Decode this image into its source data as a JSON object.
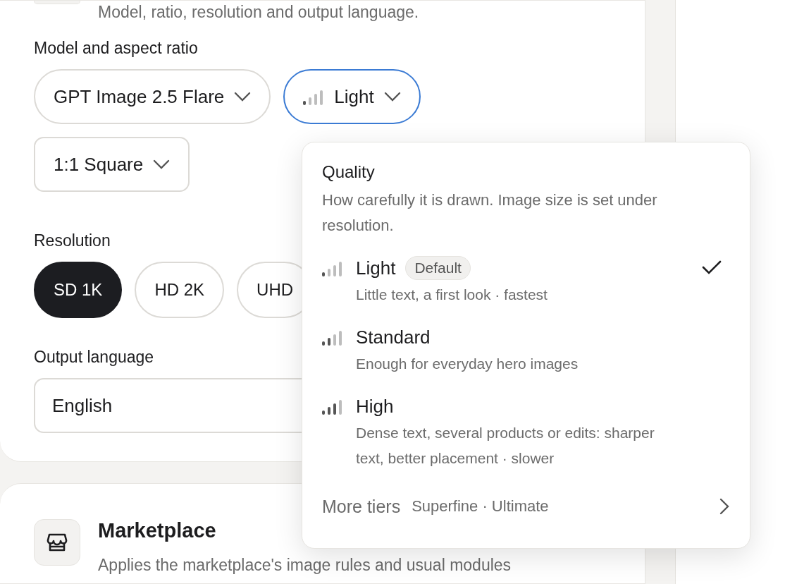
{
  "section": {
    "description": "Model, ratio, resolution and output language."
  },
  "model_group": {
    "label": "Model and aspect ratio",
    "model": "GPT Image 2.5 Flare",
    "quality": "Light",
    "quality_open": true,
    "aspect_ratio": "1:1 Square"
  },
  "resolution": {
    "label": "Resolution",
    "options": [
      {
        "label": "SD 1K",
        "selected": true
      },
      {
        "label": "HD 2K",
        "selected": false
      },
      {
        "label": "UHD",
        "selected": false
      }
    ]
  },
  "output_language": {
    "label": "Output language",
    "value": "English"
  },
  "quality_menu": {
    "title": "Quality",
    "description": "How carefully it is drawn. Image size is set under resolution.",
    "options": [
      {
        "label": "Light",
        "badge": "Default",
        "detail": "Little text, a first look · fastest",
        "selected": true
      },
      {
        "label": "Standard",
        "detail": "Enough for everyday hero images",
        "selected": false
      },
      {
        "label": "High",
        "detail": "Dense text, several products or edits: sharper text, better placement · slower",
        "selected": false
      }
    ],
    "more": {
      "label": "More tiers",
      "detail": "Superfine · Ultimate"
    }
  },
  "marketplace": {
    "title": "Marketplace",
    "description": "Applies the marketplace's image rules and usual modules"
  }
}
